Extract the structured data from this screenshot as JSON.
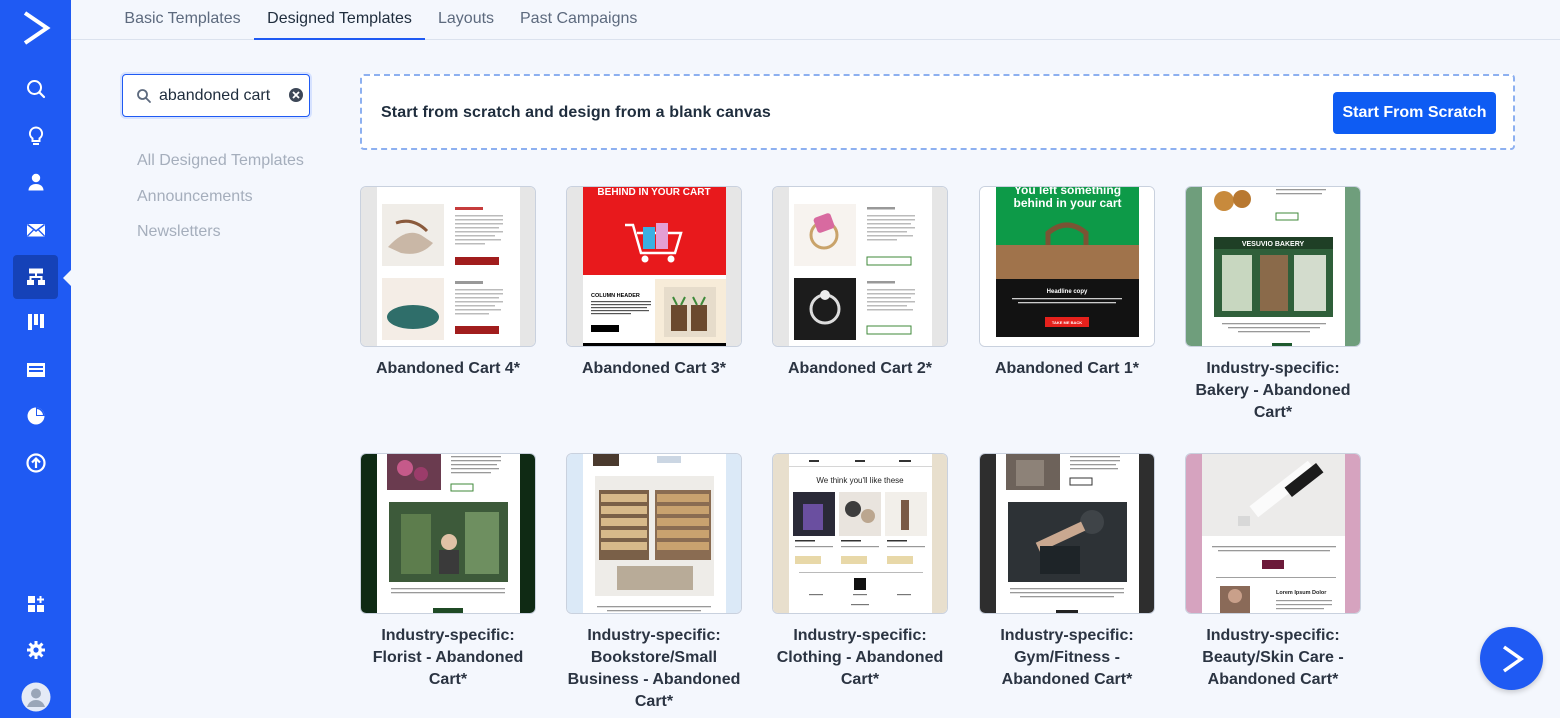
{
  "tabs": [
    {
      "label": "Basic Templates"
    },
    {
      "label": "Designed Templates"
    },
    {
      "label": "Layouts"
    },
    {
      "label": "Past Campaigns"
    }
  ],
  "active_tab": "Designed Templates",
  "search": {
    "value": "abandoned cart"
  },
  "categories": [
    {
      "label": "All Designed Templates"
    },
    {
      "label": "Announcements"
    },
    {
      "label": "Newsletters"
    }
  ],
  "banner": {
    "text": "Start from scratch and design from a blank canvas",
    "button_label": "Start From Scratch"
  },
  "templates": [
    {
      "title": "Abandoned Cart 4*"
    },
    {
      "title": "Abandoned Cart 3*",
      "thumb_text": [
        "BEHIND IN YOUR CART",
        "COLUMN HEADER"
      ]
    },
    {
      "title": "Abandoned Cart 2*"
    },
    {
      "title": "Abandoned Cart 1*",
      "thumb_text": [
        "You left something behind in your cart",
        "Headline copy",
        "TAKE ME BACK"
      ]
    },
    {
      "title": "Industry-specific: Bakery - Abandoned Cart*",
      "thumb_text": [
        "VESUVIO BAKERY"
      ]
    },
    {
      "title": "Industry-specific: Florist - Abandoned Cart*"
    },
    {
      "title": "Industry-specific: Bookstore/Small Business - Abandoned Cart*"
    },
    {
      "title": "Industry-specific: Clothing - Abandoned Cart*",
      "thumb_text": [
        "We think you'll like these"
      ]
    },
    {
      "title": "Industry-specific: Gym/Fitness - Abandoned Cart*"
    },
    {
      "title": "Industry-specific: Beauty/Skin Care - Abandoned Cart*",
      "thumb_text": [
        "Lorem Ipsum Dolor"
      ]
    }
  ],
  "colors": {
    "brand": "#1f5af3",
    "button": "#0e5cf3",
    "background": "#f4f7fd"
  },
  "sidebar_icons": [
    "logo-icon",
    "search-icon",
    "lightbulb-icon",
    "contacts-icon",
    "email-icon",
    "automations-icon",
    "pipelines-icon",
    "website-icon",
    "reports-icon",
    "upgrade-icon",
    "apps-icon",
    "settings-icon",
    "profile-icon"
  ]
}
